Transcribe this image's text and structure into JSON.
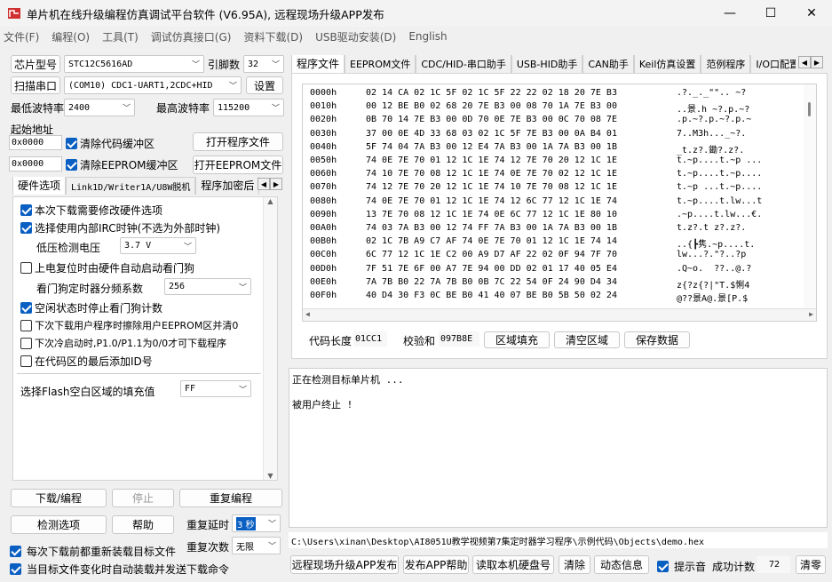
{
  "window": {
    "title": "单片机在线升级编程仿真调试平台软件 (V6.95A), 远程现场升级APP发布",
    "minimize": "—",
    "maximize": "☐",
    "close": "✕"
  },
  "menu": [
    "文件(F)",
    "编程(O)",
    "工具(T)",
    "调试仿真接口(G)",
    "资料下载(D)",
    "USB驱动安装(D)",
    "English"
  ],
  "left": {
    "chip_btn": "芯片型号",
    "chip_value": "STC12C5616AD",
    "pins_label": "引脚数",
    "pins_value": "32",
    "scan_btn": "扫描串口",
    "port_value": "(COM10) CDC1-UART1,2CDC+HID",
    "settings_btn": "设置",
    "min_baud_label": "最低波特率",
    "min_baud": "2400",
    "max_baud_label": "最高波特率",
    "max_baud": "115200",
    "start_addr_label": "起始地址",
    "addr1": "0x0000",
    "clear_code": "清除代码缓冲区",
    "open_prog": "打开程序文件",
    "addr2": "0x0000",
    "clear_eeprom": "清除EEPROM缓冲区",
    "open_eeprom": "打开EEPROM文件",
    "tabs": [
      "硬件选项",
      "Link1D/Writer1A/U8W脱机",
      "程序加密后"
    ],
    "options": [
      {
        "label": "本次下载需要修改硬件选项",
        "checked": true
      },
      {
        "label": "选择使用内部IRC时钟(不选为外部时钟)",
        "checked": true
      },
      {
        "label": "上电复位时由硬件自动启动看门狗",
        "checked": false
      },
      {
        "label": "空闲状态时停止看门狗计数",
        "checked": true
      },
      {
        "label": "下次下载用户程序时擦除用户EEPROM区并清0",
        "checked": false
      },
      {
        "label": "下次冷启动时,P1.0/P1.1为0/0才可下载程序",
        "checked": false
      },
      {
        "label": "在代码区的最后添加ID号",
        "checked": false
      }
    ],
    "low_volt_label": "低压检测电压",
    "low_volt": "3.7 V",
    "wdt_label": "看门狗定时器分频系数",
    "wdt": "256",
    "fill_label": "选择Flash空白区域的填充值",
    "fill": "FF",
    "download_btn": "下载/编程",
    "stop_btn": "停止",
    "reprogram_btn": "重复编程",
    "check_btn": "检测选项",
    "help_btn": "帮助",
    "delay_label": "重复延时",
    "delay": "3 秒",
    "count_label": "重复次数",
    "count": "无限",
    "reload1": "每次下载前都重新装载目标文件",
    "reload2": "当目标文件变化时自动装载并发送下载命令"
  },
  "right": {
    "tabs": [
      "程序文件",
      "EEPROM文件",
      "CDC/HID-串口助手",
      "USB-HID助手",
      "CAN助手",
      "Keil仿真设置",
      "范例程序",
      "I/O口配置"
    ],
    "hex": [
      {
        "addr": "0000h",
        "bytes": "02 14 CA 02 1C 5F 02 1C 5F 22 22 02 18 20 7E B3",
        "ascii": ".?._._\"\".. ~?"
      },
      {
        "addr": "0010h",
        "bytes": "00 12 BE B0 02 68 20 7E B3 00 08 70 1A 7E B3 00",
        "ascii": "..景.h ~?.p.~?"
      },
      {
        "addr": "0020h",
        "bytes": "0B 70 14 7E B3 00 0D 70 0E 7E B3 00 0C 70 08 7E",
        "ascii": ".p.~?.p.~?.p.~"
      },
      {
        "addr": "0030h",
        "bytes": "37 00 0E 4D 33 68 03 02 1C 5F 7E B3 00 0A B4 01",
        "ascii": "7..M3h..._~?."
      },
      {
        "addr": "0040h",
        "bytes": "5F 74 04 7A B3 00 12 E4 7A B3 00 1A 7A B3 00 1B",
        "ascii": "_t.z?.鋤?.z?."
      },
      {
        "addr": "0050h",
        "bytes": "74 0E 7E 70 01 12 1C 1E 74 12 7E 70 20 12 1C 1E",
        "ascii": "t.~p....t.~p ..."
      },
      {
        "addr": "0060h",
        "bytes": "74 10 7E 70 08 12 1C 1E 74 0E 7E 70 02 12 1C 1E",
        "ascii": "t.~p....t.~p...."
      },
      {
        "addr": "0070h",
        "bytes": "74 12 7E 70 20 12 1C 1E 74 10 7E 70 08 12 1C 1E",
        "ascii": "t.~p ...t.~p...."
      },
      {
        "addr": "0080h",
        "bytes": "74 0E 7E 70 01 12 1C 1E 74 12 6C 77 12 1C 1E 74",
        "ascii": "t.~p....t.lw...t"
      },
      {
        "addr": "0090h",
        "bytes": "13 7E 70 08 12 1C 1E 74 0E 6C 77 12 1C 1E 80 10",
        "ascii": ".~p....t.lw...€."
      },
      {
        "addr": "00A0h",
        "bytes": "74 03 7A B3 00 12 74 FF 7A B3 00 1A 7A B3 00 1B",
        "ascii": "t.z?.t z?.z?."
      },
      {
        "addr": "00B0h",
        "bytes": "02 1C 7B A9 C7 AF 74 0E 7E 70 01 12 1C 1E 74 14",
        "ascii": "..{┣隽.~p....t."
      },
      {
        "addr": "00C0h",
        "bytes": "6C 77 12 1C 1E C2 00 A9 D7 AF 22 02 0F 94 7F 70",
        "ascii": "lw...?.\"?..?p"
      },
      {
        "addr": "00D0h",
        "bytes": "7F 51 7E 6F 00 A7 7E 94 00 DD 02 01 17 40 05 E4",
        "ascii": ".Q~o.  ??..@.?"
      },
      {
        "addr": "00E0h",
        "bytes": "7A 7B B0 22 7A 7B B0 0B 7C 22 54 0F 24 90 D4 34",
        "ascii": "z{?z{?|\"T.$悧4"
      },
      {
        "addr": "00F0h",
        "bytes": "40 D4 30 F3 0C BE B0 41 40 07 BE B0 5B 50 02 24",
        "ascii": "@??景A@.景[P.$"
      }
    ],
    "code_len_label": "代码长度",
    "code_len": "01CC1",
    "checksum_label": "校验和",
    "checksum": "097B8E",
    "fill_area_btn": "区域填充",
    "clear_area_btn": "清空区域",
    "save_btn": "保存数据",
    "log": [
      "正在检测目标单片机 ...",
      "",
      "被用户终止 !"
    ],
    "path": "C:\\Users\\xinan\\Desktop\\AI8051U教学视频第7集定时器学习程序\\示例代码\\Objects\\demo.hex",
    "remote_btn": "远程现场升级APP发布",
    "publish_btn": "发布APP帮助",
    "read_disk_btn": "读取本机硬盘号",
    "clear_btn": "清除",
    "dynamic_btn": "动态信息",
    "beep_label": "提示音",
    "success_label": "成功计数",
    "success_count": "72",
    "reset_btn": "清零"
  }
}
